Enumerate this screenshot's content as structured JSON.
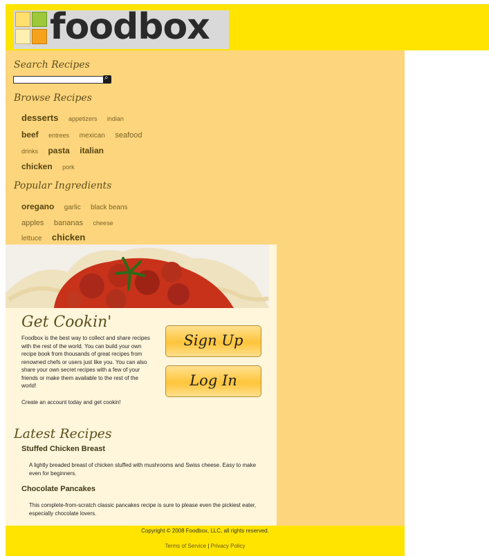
{
  "header": {
    "logo_text": "foodbox"
  },
  "search": {
    "title": "Search Recipes",
    "placeholder": ""
  },
  "browse": {
    "title": "Browse Recipes",
    "rows": [
      [
        "desserts",
        "appetizers",
        "indian"
      ],
      [
        "beef",
        "entrees",
        "mexican",
        "seafood"
      ],
      [
        "drinks",
        "pasta",
        "italian"
      ],
      [
        "chicken",
        "pork"
      ]
    ]
  },
  "ingredients": {
    "title": "Popular Ingredients",
    "rows": [
      [
        "oregano",
        "garlic",
        "black beans"
      ],
      [
        "apples",
        "bananas",
        "cheese"
      ],
      [
        "lettuce",
        "chicken"
      ]
    ]
  },
  "cookin": {
    "title": "Get Cookin'",
    "intro": "Foodbox is the best way to collect and share recipes with the rest of the world. You can build your own recipe book from thousands of great recipes from renowned chefs or users just like you. You can also share your own secret recipes with a few of your friends or make them available to the rest of the world!",
    "cta": "Create an account today and get cookin!",
    "signup_label": "Sign Up",
    "login_label": "Log In"
  },
  "latest": {
    "title": "Latest Recipes",
    "recipes": [
      {
        "title": "Stuffed Chicken Breast",
        "desc": "A lightly breaded breast of chicken stuffed with mushrooms and Swiss cheese. Easy to make even for beginners."
      },
      {
        "title": "Chocolate Pancakes",
        "desc": "This complete-from-scratch classic pancakes recipe is sure to please even the pickiest eater, especially chocolate lovers."
      }
    ]
  },
  "footer": {
    "copyright": "Copyright © 2008 Foodbox, LLC, all rights reserved.",
    "terms": "Terms of Service",
    "separator": "|",
    "privacy": "Privacy Policy"
  },
  "colors": {
    "header": "#ffe400",
    "sidebar": "#fdd57d",
    "panel": "#fff6dc",
    "button": "#ffc43a"
  }
}
